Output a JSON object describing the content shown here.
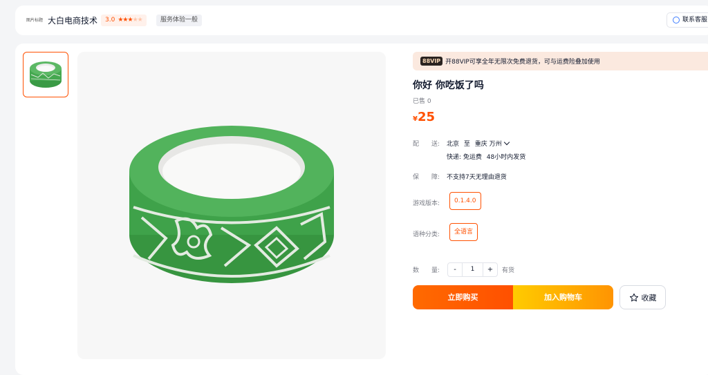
{
  "shop": {
    "logo_text": "图片标题",
    "name": "大白电商技术",
    "rating": "3.0",
    "stars_filled": 3,
    "stars_total": 5,
    "service_tag": "服务体验一般",
    "service_button": "联系客服"
  },
  "vip": {
    "badge": "88VIP",
    "text": "开88VIP可享全年无限次免费退货，可与运费险叠加使用"
  },
  "product": {
    "title": "你好 你吃饭了吗",
    "sold": "已售 0",
    "currency": "¥",
    "price": "25"
  },
  "delivery": {
    "label": "配　　送:",
    "from": "北京",
    "to_word": "至",
    "to": "重庆 万州",
    "shipping": "快递: 免运费",
    "dispatch": "48小时内发货"
  },
  "guarantee": {
    "label": "保　　障:",
    "value": "不支持7天无理由退货"
  },
  "sku": {
    "version_label": "游戏版本:",
    "version_value": "0.1.4.0",
    "language_label": "语种分类:",
    "language_value": "全语言"
  },
  "quantity": {
    "label": "数　　量:",
    "minus": "-",
    "value": "1",
    "plus": "+",
    "stock": "有货"
  },
  "actions": {
    "buy_now": "立即购买",
    "add_cart": "加入购物车",
    "favorite": "收藏"
  },
  "colors": {
    "accent": "#ff5000",
    "tape_green": "#3fa24a"
  },
  "icons": [
    "star-icon",
    "headset-icon",
    "chevron-down-icon",
    "star-outline-icon"
  ]
}
